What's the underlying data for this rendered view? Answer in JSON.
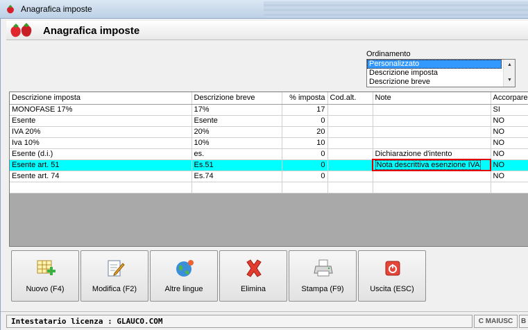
{
  "window": {
    "title": "Anagrafica imposte"
  },
  "header": {
    "heading": "Anagrafica imposte"
  },
  "ordering": {
    "label": "Ordinamento",
    "options": [
      "Personalizzato",
      "Descrizione imposta",
      "Descrizione breve"
    ],
    "selected": "Personalizzato"
  },
  "grid": {
    "columns": [
      "Descrizione imposta",
      "Descrizione breve",
      "% imposta",
      "Cod.alt.",
      "Note",
      "Accorpare"
    ],
    "rows": [
      {
        "descrizione": "MONOFASE 17%",
        "breve": "17%",
        "imposta": "17",
        "codalt": "",
        "note": "",
        "accorpare": "SI"
      },
      {
        "descrizione": "Esente",
        "breve": "Esente",
        "imposta": "0",
        "codalt": "",
        "note": "",
        "accorpare": "NO"
      },
      {
        "descrizione": "IVA 20%",
        "breve": "20%",
        "imposta": "20",
        "codalt": "",
        "note": "",
        "accorpare": "NO"
      },
      {
        "descrizione": "Iva 10%",
        "breve": "10%",
        "imposta": "10",
        "codalt": "",
        "note": "",
        "accorpare": "NO"
      },
      {
        "descrizione": "Esente (d.i.)",
        "breve": "es.",
        "imposta": "0",
        "codalt": "",
        "note": "Dichiarazione d'intento",
        "accorpare": "NO"
      },
      {
        "descrizione": "Esente art. 51",
        "breve": "Es.51",
        "imposta": "0",
        "codalt": "",
        "note": "Nota descrittiva esenzione IVA",
        "accorpare": "NO"
      },
      {
        "descrizione": "Esente art. 74",
        "breve": "Es.74",
        "imposta": "0",
        "codalt": "",
        "note": "",
        "accorpare": "NO"
      }
    ],
    "selected_row": 5
  },
  "toolbar": {
    "buttons": [
      {
        "label": "Nuovo (F4)",
        "icon": "new-table-icon"
      },
      {
        "label": "Modifica (F2)",
        "icon": "edit-document-icon"
      },
      {
        "label": "Altre lingue",
        "icon": "globe-icon"
      },
      {
        "label": "Elimina",
        "icon": "delete-x-icon"
      },
      {
        "label": "Stampa (F9)",
        "icon": "printer-icon"
      },
      {
        "label": "Uscita (ESC)",
        "icon": "exit-power-icon"
      }
    ]
  },
  "status": {
    "license": "Intestatario licenza : GLAUCO.COM",
    "caps": "C MAIUSC",
    "extra": "B"
  },
  "colors": {
    "selected_row": "#00ffff",
    "highlight_frame": "#e00000",
    "list_selection": "#3399ff"
  }
}
